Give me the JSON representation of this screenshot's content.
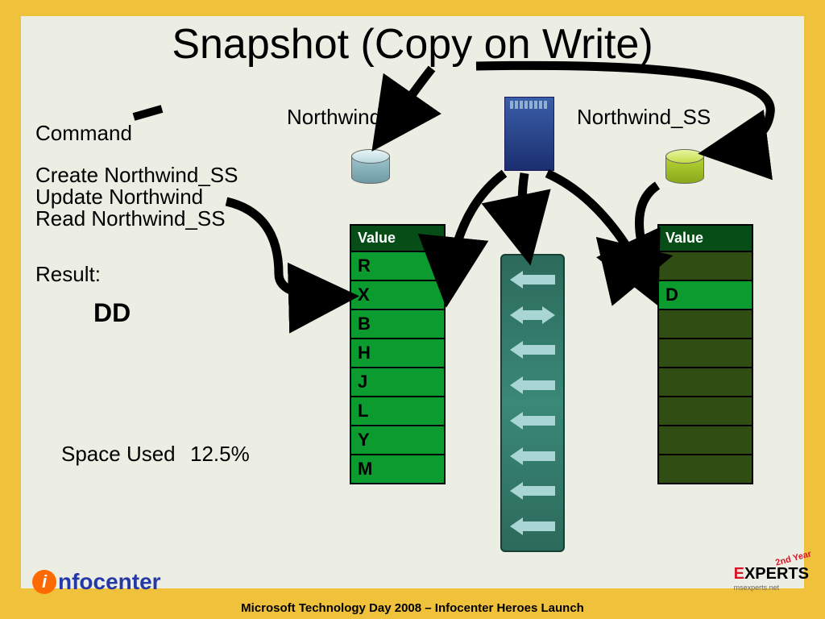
{
  "title": "Snapshot (Copy on Write)",
  "labels": {
    "command": "Command",
    "northwind": "Northwind",
    "northwind_ss": "Northwind_SS",
    "result": "Result:",
    "space_used": "Space Used",
    "value_hdr": "Value"
  },
  "commands": {
    "line1": "Create Northwind_SS",
    "line2": "Update Northwind",
    "line3": "Read Northwind_SS"
  },
  "result_value": "DD",
  "space_used_value": "12.5%",
  "northwind_rows": [
    "R",
    "X",
    "B",
    "H",
    "J",
    "L",
    "Y",
    "M"
  ],
  "ss_rows": [
    "",
    "D",
    "",
    "",
    "",
    "",
    "",
    ""
  ],
  "footer": "Microsoft Technology Day 2008 – Infocenter Heroes Launch",
  "logo_left": "nfocenter",
  "logo_right": {
    "pre": "E",
    "rest": "XPERTS",
    "sub": "msexperts.net",
    "year": "2nd Year"
  }
}
